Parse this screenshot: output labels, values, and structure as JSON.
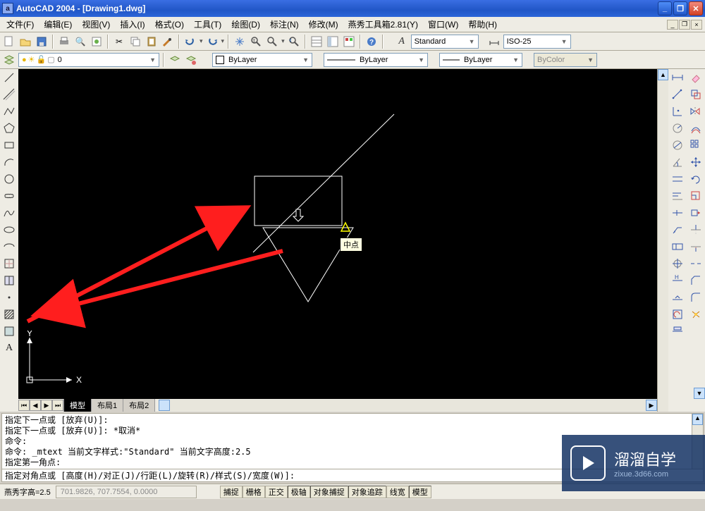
{
  "title": "AutoCAD 2004 - [Drawing1.dwg]",
  "menus": [
    "文件(F)",
    "编辑(E)",
    "视图(V)",
    "插入(I)",
    "格式(O)",
    "工具(T)",
    "绘图(D)",
    "标注(N)",
    "修改(M)",
    "燕秀工具箱2.81(Y)",
    "窗口(W)",
    "帮助(H)"
  ],
  "styles": {
    "text": "Standard",
    "dim": "ISO-25",
    "layer": "ByLayer",
    "linetype": "ByLayer",
    "lineweight": "ByLayer",
    "color": "ByColor",
    "layer0": "0"
  },
  "tabs": {
    "active": "模型",
    "others": [
      "布局1",
      "布局2"
    ]
  },
  "cmd": {
    "lines": [
      "指定下一点或 [放弃(U)]:",
      "指定下一点或 [放弃(U)]:  *取消*",
      "命令:",
      "命令: _mtext 当前文字样式:\"Standard\"  当前文字高度:2.5",
      "指定第一角点:"
    ],
    "prompt": "指定对角点或 [高度(H)/对正(J)/行距(L)/旋转(R)/样式(S)/宽度(W)]:"
  },
  "status": {
    "left": "燕秀字高=2.5",
    "coords": "701.9826,  707.7554,  0.0000",
    "toggles": [
      "捕捉",
      "栅格",
      "正交",
      "极轴",
      "对象捕捉",
      "对象追踪",
      "线宽",
      "模型"
    ]
  },
  "tooltip": "中点",
  "ucs": {
    "x": "X",
    "y": "Y"
  },
  "watermark": {
    "brand": "溜溜自学",
    "url": "zixue.3d66.com"
  }
}
